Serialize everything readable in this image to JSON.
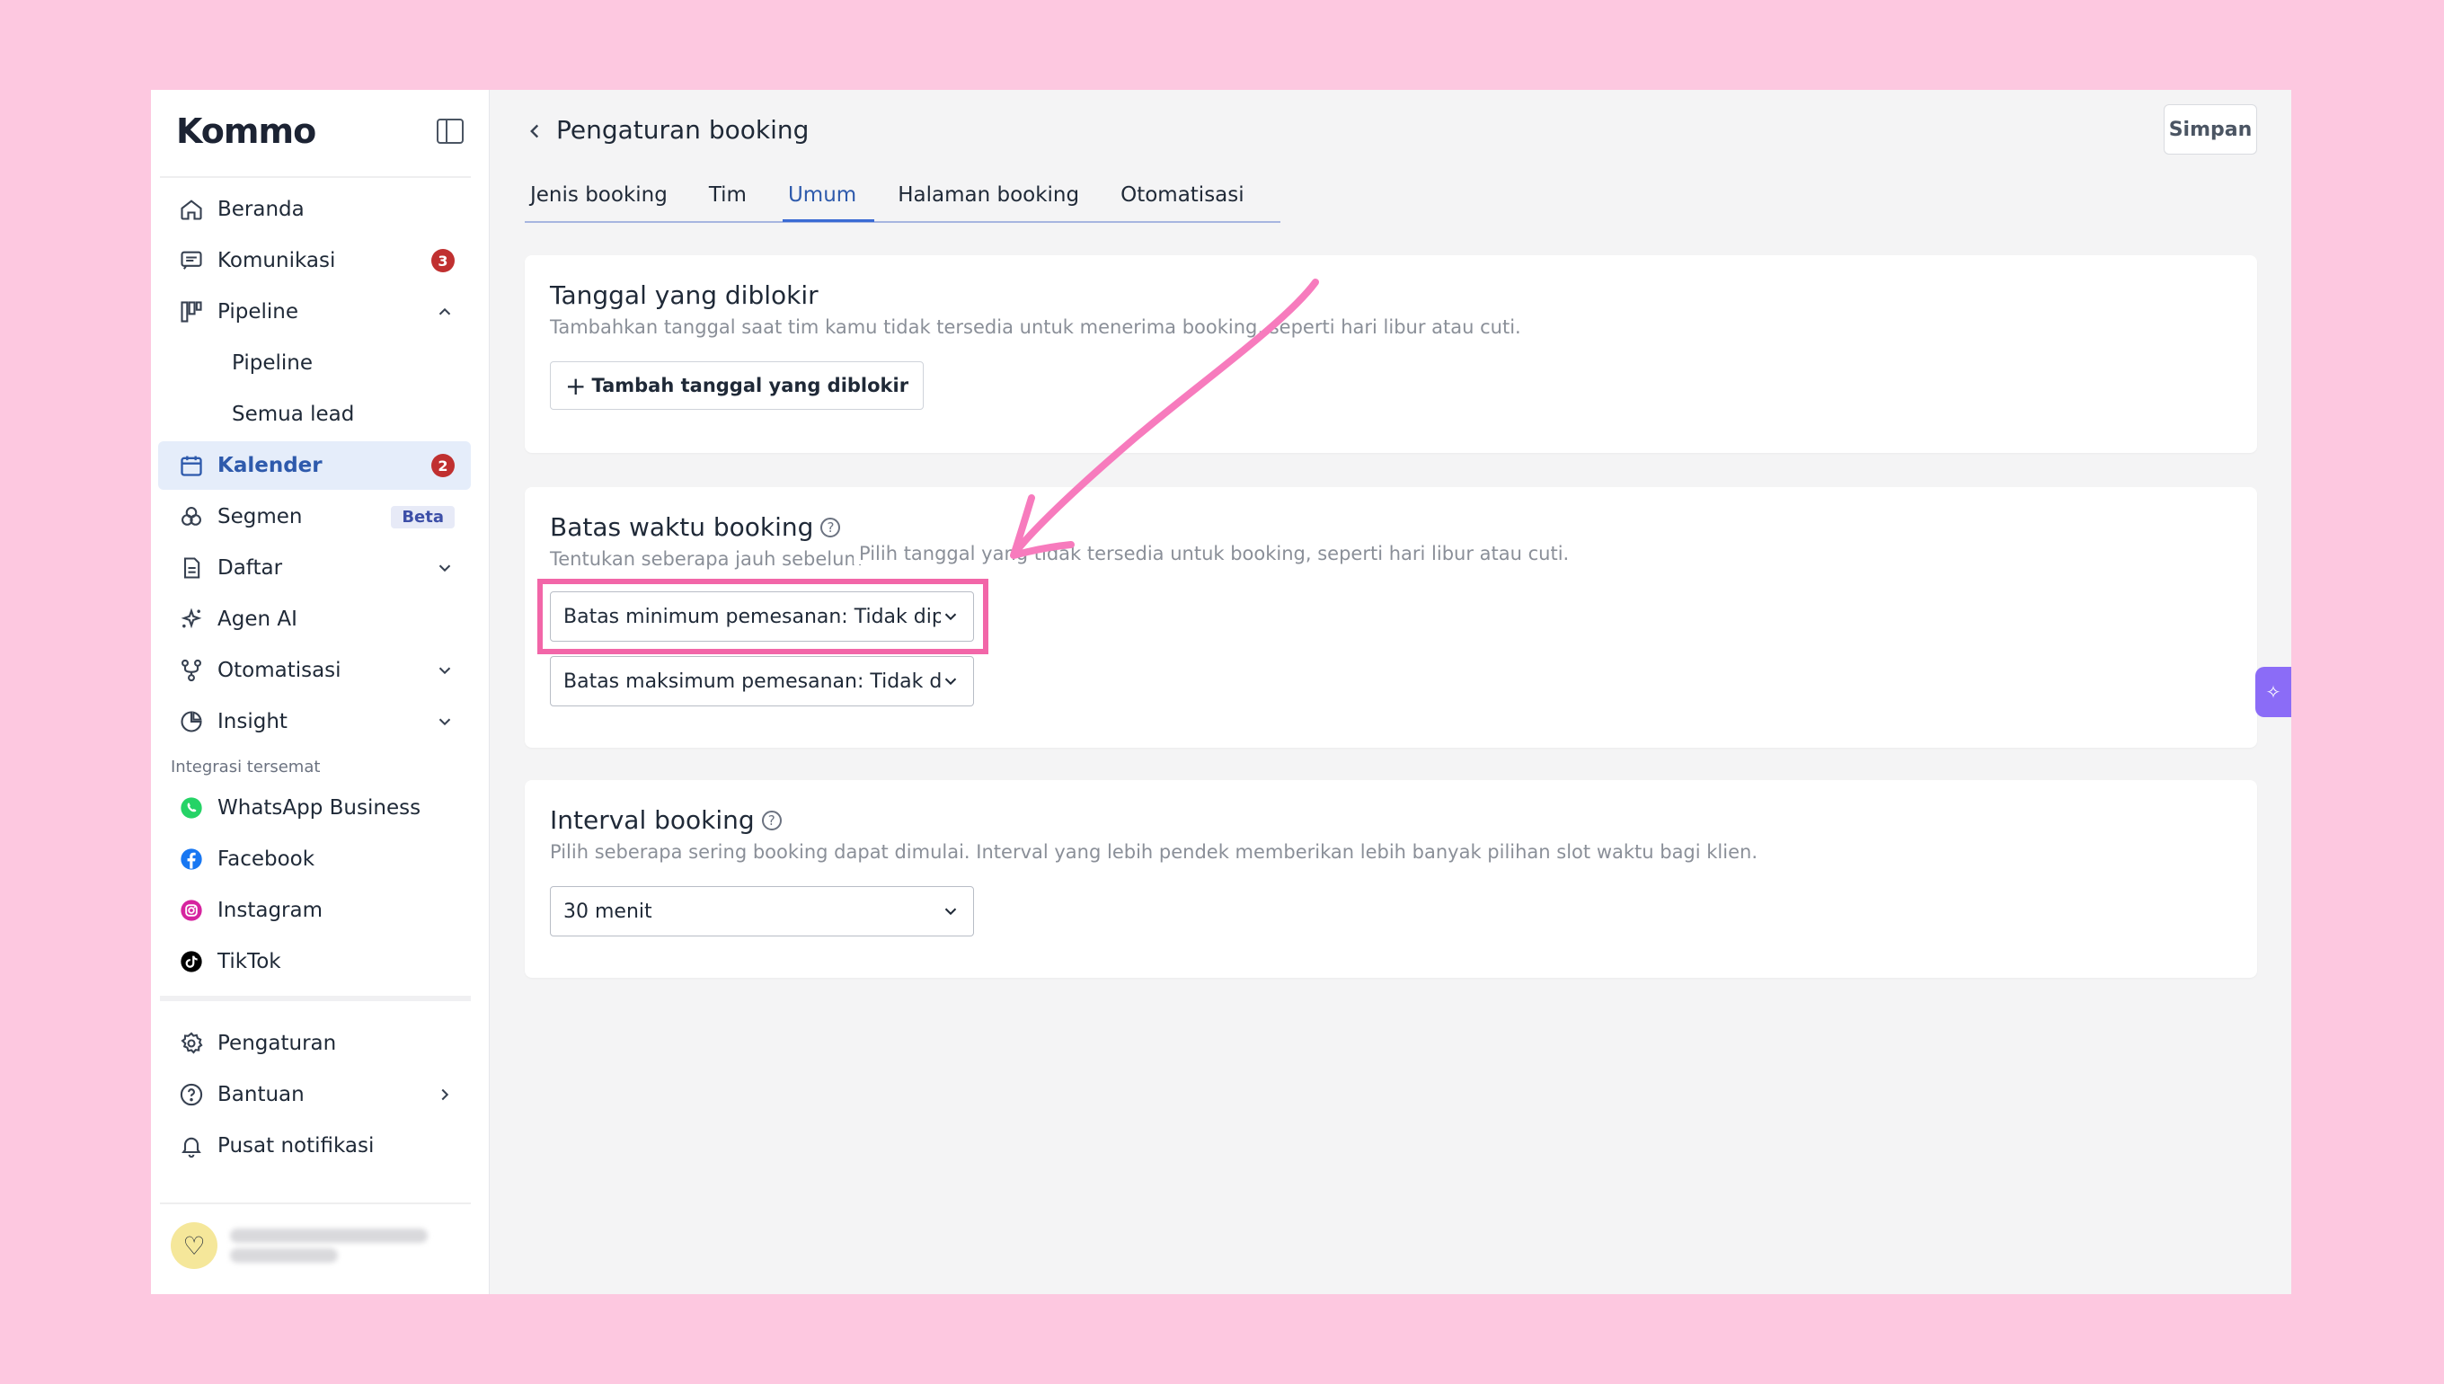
{
  "sidebar": {
    "logo": "Kommo",
    "items": [
      {
        "label": "Beranda",
        "icon": "home-icon"
      },
      {
        "label": "Komunikasi",
        "icon": "chat-icon",
        "badge": "3"
      },
      {
        "label": "Pipeline",
        "icon": "pipeline-icon"
      },
      {
        "label": "Pipeline"
      },
      {
        "label": "Semua lead"
      },
      {
        "label": "Kalender",
        "icon": "calendar-icon",
        "badge": "2"
      },
      {
        "label": "Segmen",
        "icon": "segment-icon",
        "badge": "Beta"
      },
      {
        "label": "Daftar",
        "icon": "list-icon"
      },
      {
        "label": "Agen AI",
        "icon": "sparkle-icon"
      },
      {
        "label": "Otomatisasi",
        "icon": "automation-icon"
      },
      {
        "label": "Insight",
        "icon": "chart-icon"
      }
    ],
    "integrations_label": "Integrasi tersemat",
    "integrations": [
      {
        "label": "WhatsApp Business",
        "icon": "whatsapp-icon",
        "color": "#25d366"
      },
      {
        "label": "Facebook",
        "icon": "facebook-icon",
        "color": "#1877f2"
      },
      {
        "label": "Instagram",
        "icon": "instagram-icon",
        "color": "#d6249f"
      },
      {
        "label": "TikTok",
        "icon": "tiktok-icon",
        "color": "#000000"
      }
    ],
    "bottom": [
      {
        "label": "Pengaturan",
        "icon": "gear-icon"
      },
      {
        "label": "Bantuan",
        "icon": "help-icon"
      },
      {
        "label": "Pusat notifikasi",
        "icon": "bell-icon"
      }
    ]
  },
  "header": {
    "title": "Pengaturan booking",
    "save_label": "Simpan"
  },
  "tabs": [
    {
      "label": "Jenis booking"
    },
    {
      "label": "Tim"
    },
    {
      "label": "Umum",
      "active": true
    },
    {
      "label": "Halaman booking"
    },
    {
      "label": "Otomatisasi"
    }
  ],
  "blocked_dates": {
    "title": "Tanggal yang diblokir",
    "desc": "Tambahkan tanggal saat tim kamu tidak tersedia untuk menerima booking, seperti hari libur atau cuti.",
    "add_label": "Tambah tanggal yang diblokir"
  },
  "booking_window": {
    "title": "Batas waktu booking",
    "desc": "Tentukan seberapa jauh sebelum",
    "tooltip": "Pilih tanggal yang tidak tersedia untuk booking, seperti hari libur atau cuti.",
    "min_label": "Batas minimum pemesanan: Tidak dipilih",
    "max_label": "Batas maksimum pemesanan: Tidak dipilih"
  },
  "interval": {
    "title": "Interval booking",
    "desc": "Pilih seberapa sering booking dapat dimulai. Interval yang lebih pendek memberikan lebih banyak pilihan slot waktu bagi klien.",
    "value": "30 menit"
  },
  "colors": {
    "background": "#fdc8e0",
    "accent": "#2e5aac",
    "highlight": "#f266a8"
  }
}
